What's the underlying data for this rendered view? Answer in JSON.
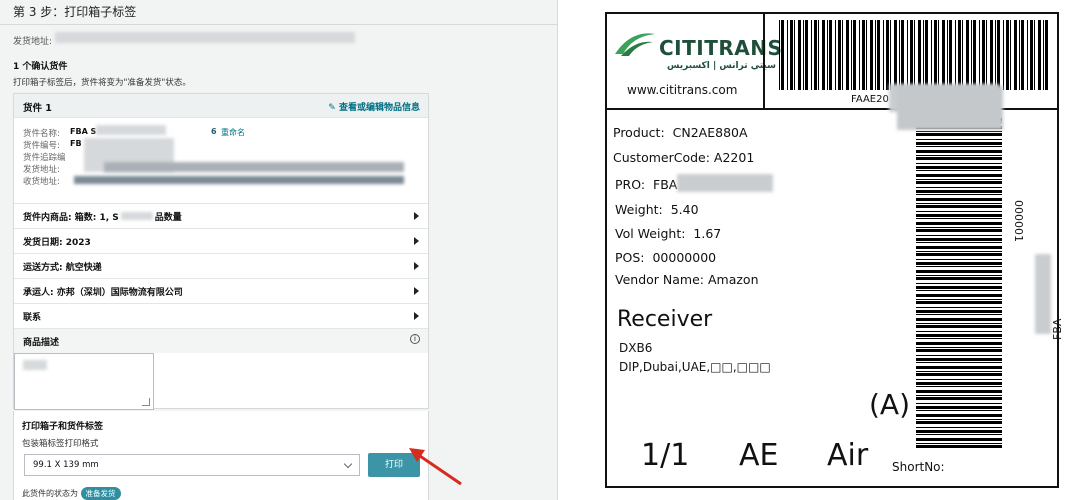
{
  "left": {
    "step_title": "第 3 步：打印箱子标签",
    "ship_from_label": "发货地址:",
    "confirm_title": "1 个确认货件",
    "confirm_note": "打印箱子标签后，货件将变为\"准备发货\"状态。",
    "shipment": {
      "title": "货件 1",
      "edit_link": "查看或编辑物品信息",
      "name_label": "货件名称:",
      "name_value_prefix": "FBA S",
      "name_count": "6",
      "rename_link": "重命名",
      "id_label": "货件编号:",
      "id_value_prefix": "FB",
      "tracking_label": "货件追踪编",
      "from_label": "发货地址:",
      "to_label": "收货地址:"
    },
    "rows": [
      {
        "label": "货件内商品: 箱数: 1, S",
        "suffix": "品数量"
      },
      {
        "label": "发货日期: 2023",
        "suffix": ""
      },
      {
        "label": "运送方式: 航空快递",
        "suffix": ""
      },
      {
        "label": "承运人: 亦邦（深圳）国际物流有限公司",
        "suffix": ""
      },
      {
        "label": "联系",
        "suffix": ""
      }
    ],
    "desc_title": "商品描述",
    "print_section_title": "打印箱子和货件标签",
    "format_label": "包装箱标签打印格式",
    "format_value": "99.1 X 139 mm",
    "print_button": "打印",
    "status_prefix": "此货件的状态为",
    "status_badge": "准备发货"
  },
  "label": {
    "brand": "CITITRANS",
    "brand_arabic": "سيتي ترانس | اكسبريس",
    "website": "www.cititrans.com",
    "top_barcode_text": "FAAE20",
    "product_label": "Product:",
    "product_value": "CN2AE880A",
    "customer_label": "CustomerCode:",
    "customer_value": "A2201",
    "pro_label": "PRO:",
    "pro_value": "FBA",
    "weight_label": "Weight:",
    "weight_value": "5.40",
    "vol_label": "Vol Weight:",
    "vol_value": "1.67",
    "pos_label": "POS:",
    "pos_value": "00000000",
    "vendor_label": "Vendor Name:",
    "vendor_value": "Amazon",
    "receiver_title": "Receiver",
    "receiver_code": "DXB6",
    "receiver_addr": "DIP,Dubai,UAE,□□,□□□",
    "side_text_top": "000001",
    "side_text_bottom": "FBA",
    "mark": "(A)",
    "count": "1/1",
    "country": "AE",
    "mode": "Air",
    "short_no_label": "ShortNo:"
  },
  "colors": {
    "accent": "#007185",
    "button": "#3b95a6",
    "logo_green": "#3aa35b",
    "logo_dark": "#1f4f3a",
    "arrow": "#d62b1f"
  }
}
